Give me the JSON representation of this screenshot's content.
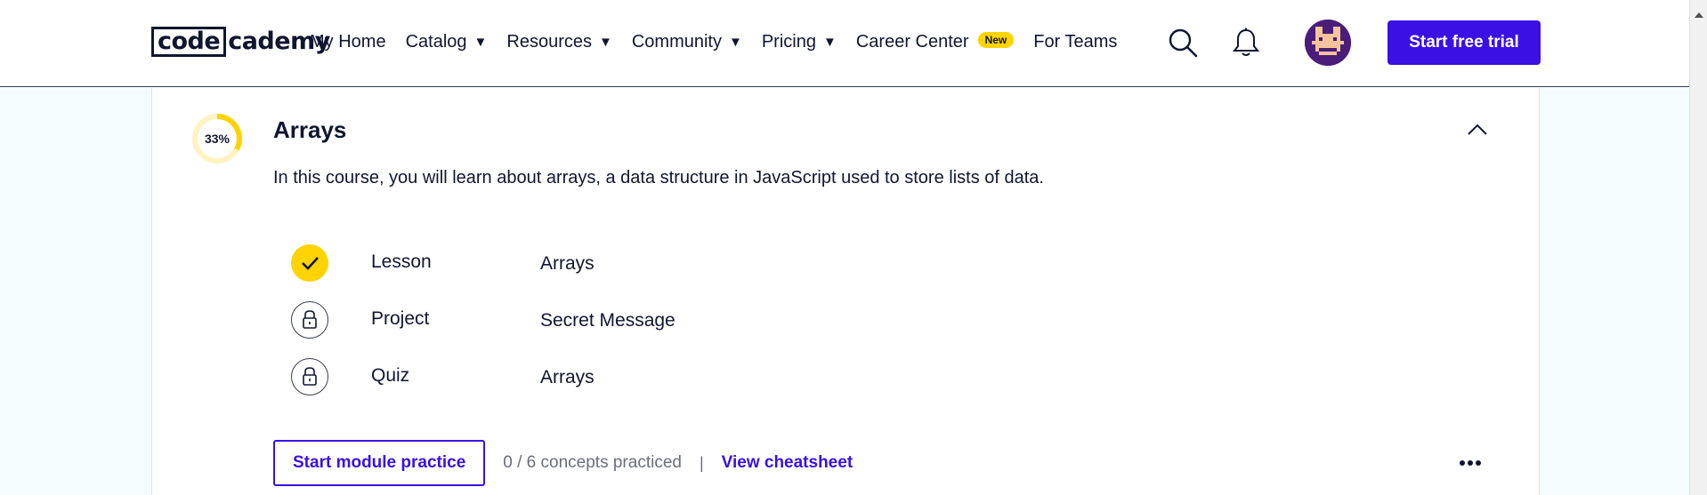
{
  "header": {
    "logo_box": "code",
    "logo_rest": "cademy",
    "nav": [
      {
        "label": "My Home",
        "has_caret": false
      },
      {
        "label": "Catalog",
        "has_caret": true
      },
      {
        "label": "Resources",
        "has_caret": true
      },
      {
        "label": "Community",
        "has_caret": true
      },
      {
        "label": "Pricing",
        "has_caret": true
      },
      {
        "label": "Career Center",
        "has_caret": false
      },
      {
        "label": "For Teams",
        "has_caret": false
      }
    ],
    "caret_glyph": "▼",
    "career_badge": "New",
    "cta_label": "Start free trial",
    "icons": [
      "search-icon",
      "bell-icon"
    ]
  },
  "module": {
    "progress_label": "33%",
    "progress_fraction": 0.33,
    "title": "Arrays",
    "description": "In this course, you will learn about arrays, a data structure in JavaScript used to store lists of data.",
    "items": [
      {
        "type": "Lesson",
        "name": "Arrays",
        "status": "completed"
      },
      {
        "type": "Project",
        "name": "Secret Message",
        "status": "locked"
      },
      {
        "type": "Quiz",
        "name": "Arrays",
        "status": "locked"
      }
    ],
    "practice_label": "Start module practice",
    "concepts_text": "0 / 6 concepts practiced",
    "separator": "|",
    "cheatsheet_label": "View cheatsheet"
  },
  "colors": {
    "brand": "#3a10e5",
    "accent_yellow": "#ffd300",
    "navy": "#10162f",
    "page_bg": "#f5fcff"
  }
}
